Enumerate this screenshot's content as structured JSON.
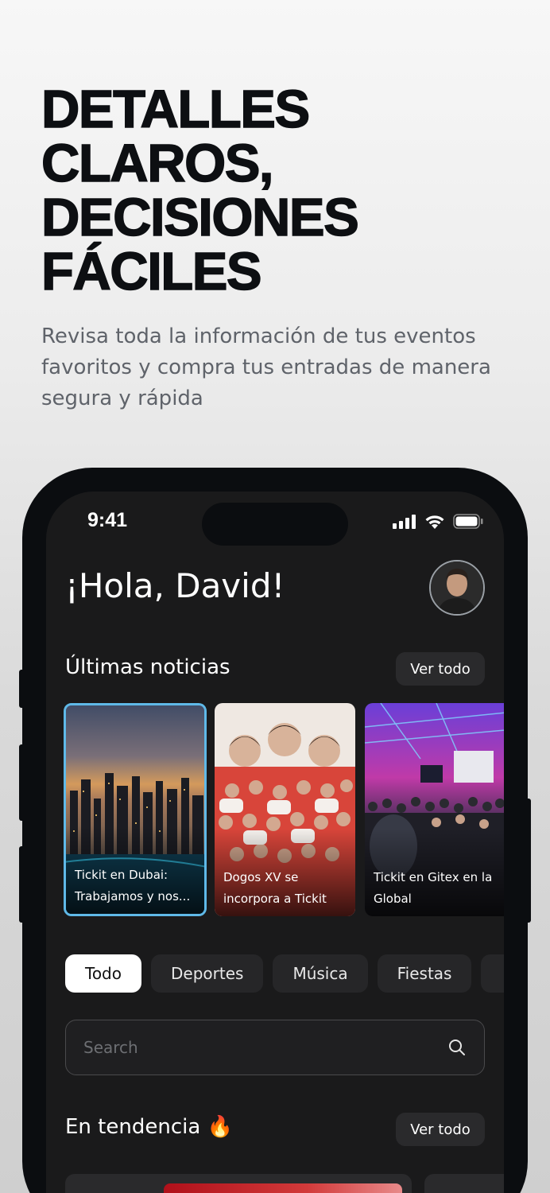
{
  "promo": {
    "headline_lines": [
      "DETALLES",
      "CLAROS,",
      "DECISIONES",
      "FÁCILES"
    ],
    "subheadline": "Revisa toda la información de tus eventos favoritos y compra tus entradas de manera segura y rápida"
  },
  "status_bar": {
    "time": "9:41",
    "icons": [
      "cellular-signal-icon",
      "wifi-icon",
      "battery-icon"
    ]
  },
  "header": {
    "greeting": "¡Hola, David!",
    "avatar_icon": "user-avatar"
  },
  "news": {
    "title": "Últimas noticias",
    "see_all": "Ver todo",
    "items": [
      {
        "caption_line1": "Tickit en Dubai:",
        "caption_line2": "Trabajamos y nos..."
      },
      {
        "caption_line1": "Dogos XV se",
        "caption_line2": "incorpora a Tickit"
      },
      {
        "caption_line1": "Tickit en Gitex en la",
        "caption_line2": "Global"
      }
    ]
  },
  "categories": {
    "items": [
      "Todo",
      "Deportes",
      "Música",
      "Fiestas"
    ],
    "selected": "Todo"
  },
  "search": {
    "placeholder": "Search",
    "icon": "search-icon"
  },
  "trending": {
    "title": "En tendencia 🔥",
    "see_all": "Ver todo"
  },
  "colors": {
    "screen_bg": "#1a1a1b",
    "accent_border": "#5fb9e8",
    "chip_selected_bg": "#ffffff"
  }
}
